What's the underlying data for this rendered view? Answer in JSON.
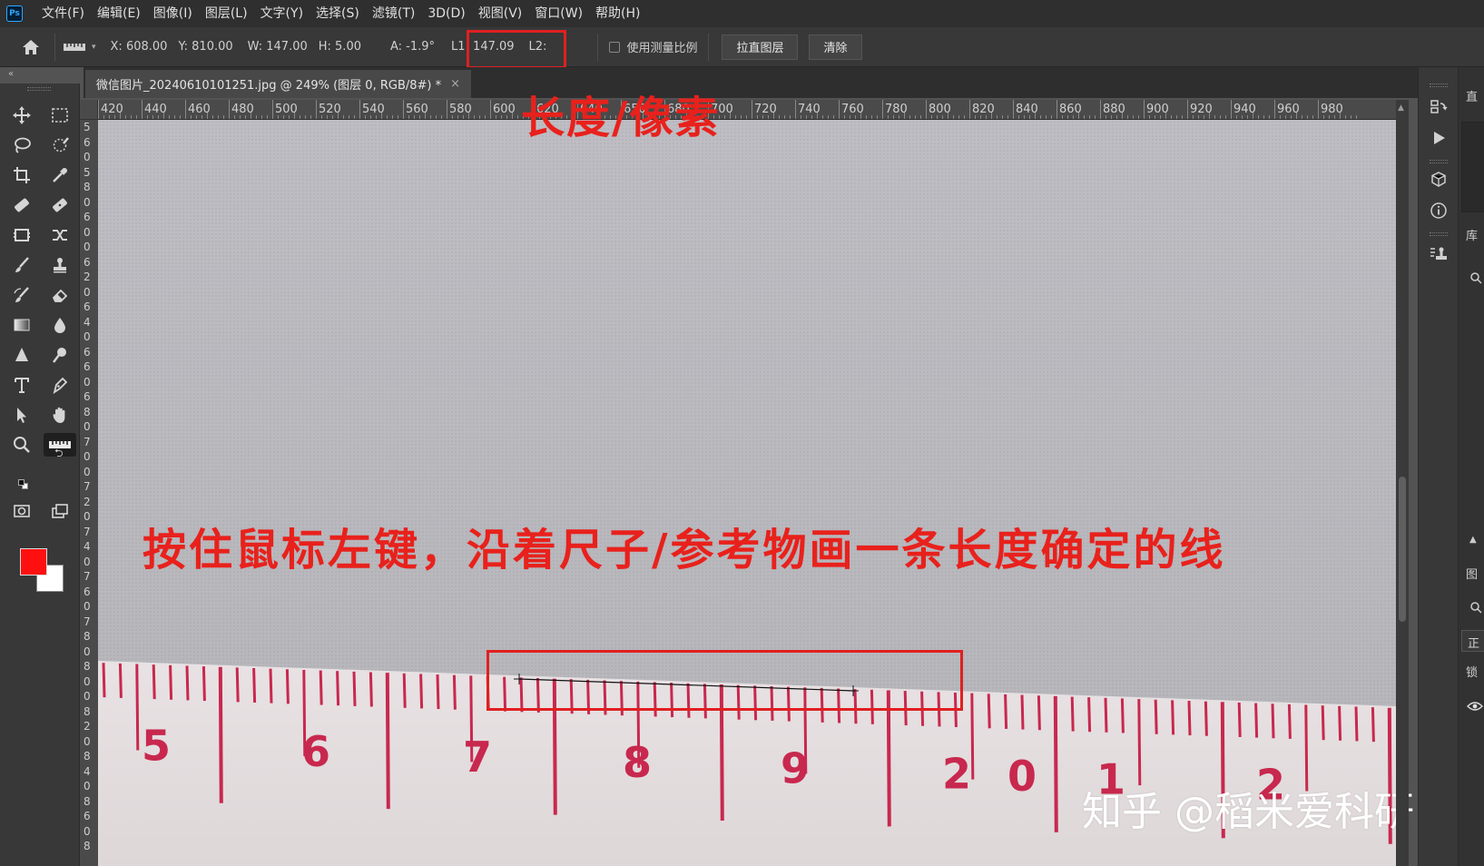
{
  "menu": {
    "logo": "Ps",
    "items": [
      "文件(F)",
      "编辑(E)",
      "图像(I)",
      "图层(L)",
      "文字(Y)",
      "选择(S)",
      "滤镜(T)",
      "3D(D)",
      "视图(V)",
      "窗口(W)",
      "帮助(H)"
    ]
  },
  "options": {
    "x": "X: 608.00",
    "y": "Y: 810.00",
    "w": "W: 147.00",
    "h": "H: 5.00",
    "a": "A: -1.9°",
    "l1": "L1: 147.09",
    "l2": "L2:",
    "use_scale_label": "使用测量比例",
    "straighten_label": "拉直图层",
    "clear_label": "清除"
  },
  "document": {
    "tab_title": "微信图片_20240610101251.jpg @ 249% (图层 0, RGB/8#) *",
    "close": "×"
  },
  "rulers": {
    "h_labels": [
      "420",
      "440",
      "460",
      "480",
      "500",
      "520",
      "540",
      "560",
      "580",
      "600",
      "620",
      "640",
      "650",
      "680",
      "700",
      "720",
      "740",
      "760",
      "780",
      "800",
      "820",
      "840",
      "860",
      "880",
      "900",
      "920",
      "940",
      "960",
      "980"
    ],
    "v_digits": [
      "5",
      "6",
      "0",
      "5",
      "8",
      "0",
      "6",
      "0",
      "0",
      "6",
      "2",
      "0",
      "6",
      "4",
      "0",
      "6",
      "6",
      "0",
      "6",
      "8",
      "0",
      "7",
      "0",
      "0",
      "7",
      "2",
      "0",
      "7",
      "4",
      "0",
      "7",
      "6",
      "0",
      "7",
      "8",
      "0",
      "8",
      "0",
      "0",
      "8",
      "2",
      "0",
      "8",
      "4",
      "0",
      "8",
      "6",
      "0",
      "8"
    ]
  },
  "photo": {
    "tape_numbers": [
      "5",
      "6",
      "7",
      "8",
      "9",
      "2",
      "0",
      "1",
      "2"
    ]
  },
  "annotations": {
    "pixel_length": "长度/像素",
    "instruction": "按住鼠标左键，沿着尺子/参考物画一条长度确定的线",
    "watermark": "知乎 @稻米爱科研"
  },
  "right_panel": {
    "labels": [
      "直",
      "库",
      "图",
      "正",
      "锁"
    ]
  },
  "colors": {
    "foreground": "#ff1010",
    "background": "#ffffff",
    "annotation": "#e8211c"
  }
}
